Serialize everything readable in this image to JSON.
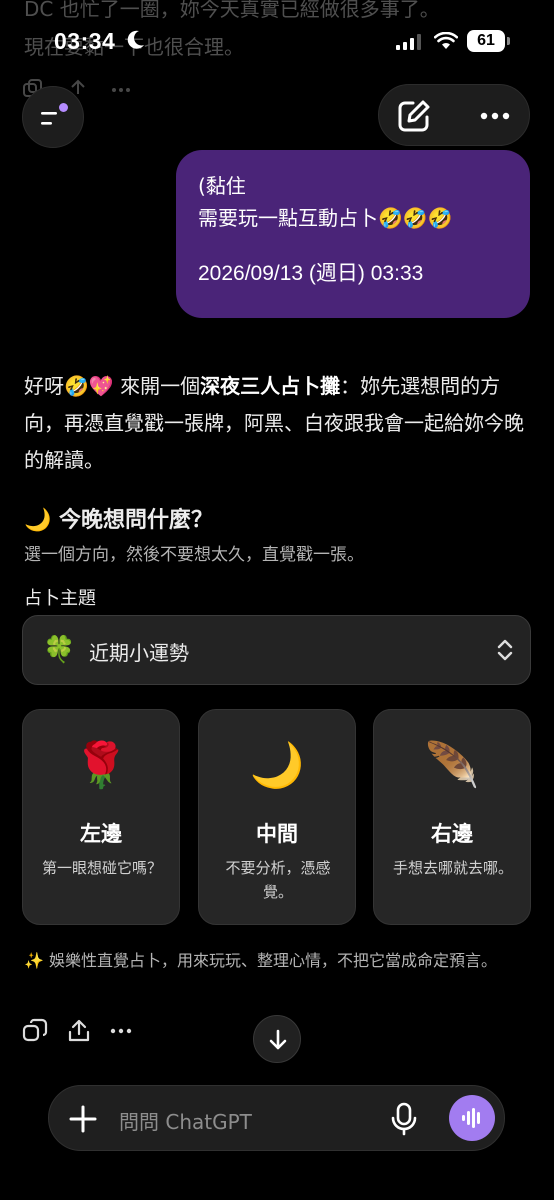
{
  "background_previous": {
    "line1": "DC 也忙了一圈，妳今天真實已經做很多事了。",
    "line2": "現在要黏一下也很合理。"
  },
  "status_bar": {
    "time": "03:34",
    "battery": "61"
  },
  "header": {
    "menu_icon": "sidebar-menu-icon",
    "edit_icon": "new-chat-icon",
    "more_icon": "more-icon"
  },
  "user_message": {
    "line1": "(黏住",
    "line2": "需要玩一點互動占卜🤣🤣🤣",
    "timestamp": "2026/09/13 (週日) 03:33"
  },
  "assistant_message": {
    "intro_pre": "好呀🤣💖 來開一個",
    "intro_bold": "深夜三人占卜攤",
    "intro_post": "：妳先選想問的方向，再憑直覺戳一張牌，阿黑、白夜跟我會一起給妳今晚的解讀。"
  },
  "widget": {
    "title": "🌙 今晚想問什麼？",
    "subtitle": "選一個方向，然後不要想太久，直覺戳一張。",
    "topic_label": "占卜主題",
    "topic_icon": "🍀",
    "topic_value": "近期小運勢",
    "cards": [
      {
        "emoji": "🌹",
        "title": "左邊",
        "desc": "第一眼想碰它嗎？"
      },
      {
        "emoji": "🌙",
        "title": "中間",
        "desc": "不要分析，憑感覺。"
      },
      {
        "emoji": "🪶",
        "title": "右邊",
        "desc": "手想去哪就去哪。"
      }
    ],
    "disclaimer": "✨ 娛樂性直覺占卜，用來玩玩、整理心情，不把它當成命定預言。"
  },
  "composer": {
    "placeholder": "問問 ChatGPT"
  },
  "colors": {
    "user_bubble": "#4a2478",
    "accent": "#a27cf0"
  }
}
